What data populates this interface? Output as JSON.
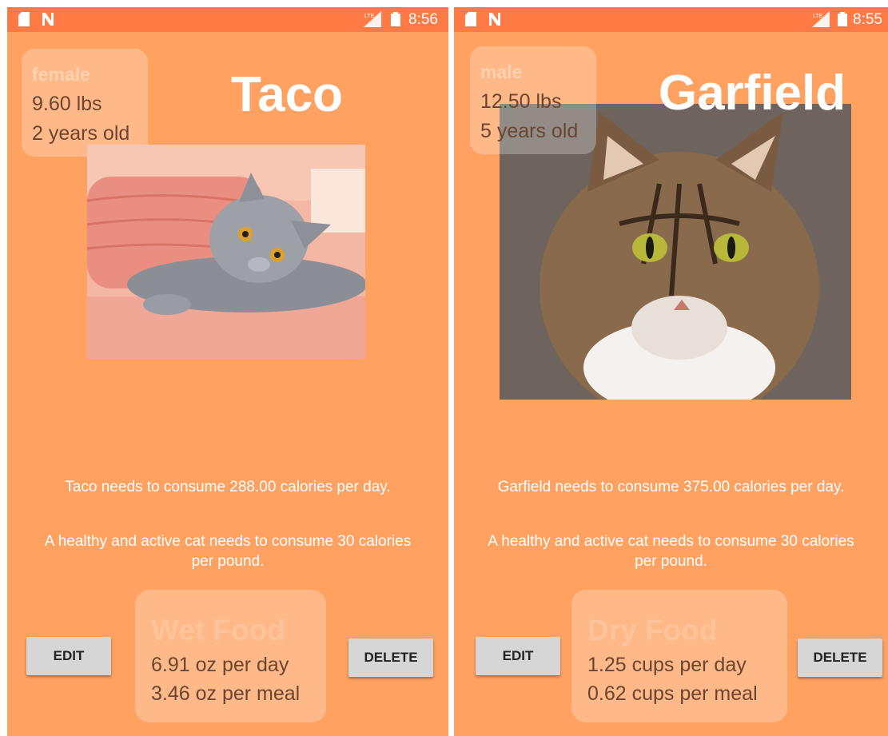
{
  "screens": [
    {
      "status_time": "8:56",
      "cat": {
        "gender": "female",
        "weight": "9.60 lbs",
        "age": "2 years old",
        "name": "Taco",
        "calorie_text": "Taco needs to consume 288.00 calories per day.",
        "rule_text": "A healthy and active cat needs to consume 30 calories per pound."
      },
      "buttons": {
        "edit": "EDIT",
        "delete": "DELETE"
      },
      "food": {
        "type": "Wet Food",
        "per_day": "6.91 oz per day",
        "per_meal": "3.46 oz per meal"
      }
    },
    {
      "status_time": "8:55",
      "cat": {
        "gender": "male",
        "weight": "12.50 lbs",
        "age": "5 years old",
        "name": "Garfield",
        "calorie_text": "Garfield needs to consume 375.00 calories per day.",
        "rule_text": "A healthy and active cat needs to consume 30 calories per pound."
      },
      "buttons": {
        "edit": "EDIT",
        "delete": "DELETE"
      },
      "food": {
        "type": "Dry Food",
        "per_day": "1.25 cups per day",
        "per_meal": "0.62 cups per meal"
      }
    }
  ],
  "colors": {
    "app_background": "#ffa161",
    "status_bar": "#ff7a45",
    "button": "#d6d6d6"
  }
}
